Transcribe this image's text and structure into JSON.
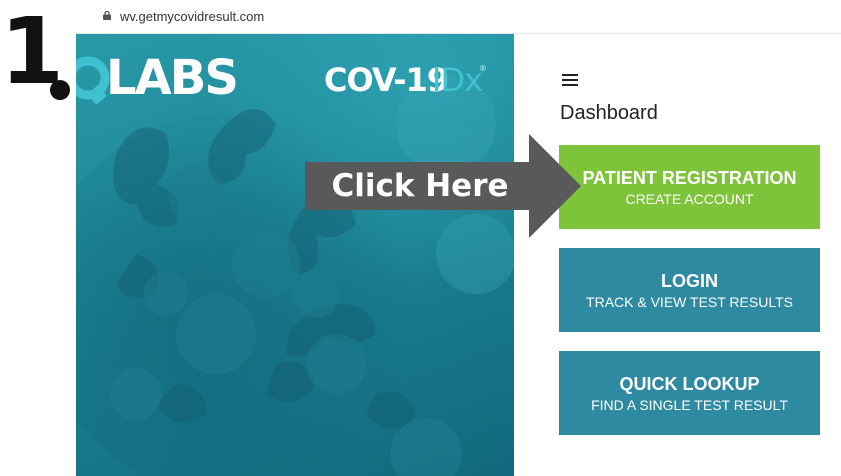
{
  "annotation": {
    "step_number": "1",
    "callout_text": "Click Here"
  },
  "browser": {
    "url": "wv.getmycovidresult.com",
    "icons": {
      "lock": "lock-icon"
    }
  },
  "hero": {
    "brand_logo": "Q",
    "brand_logo_text": "LABS",
    "product_logo_main": "COV-19",
    "product_logo_accent": "IDx",
    "product_logo_mark": "®"
  },
  "dashboard": {
    "menu_icon": "hamburger-menu-icon",
    "title": "Dashboard",
    "buttons": [
      {
        "title": "PATIENT REGISTRATION",
        "subtitle": "CREATE ACCOUNT",
        "color": "#7dc43a"
      },
      {
        "title": "LOGIN",
        "subtitle": "TRACK & VIEW TEST RESULTS",
        "color": "#2d8aa1"
      },
      {
        "title": "QUICK LOOKUP",
        "subtitle": "FIND A SINGLE TEST RESULT",
        "color": "#2d8aa1"
      }
    ]
  },
  "colors": {
    "green": "#7dc43a",
    "teal_button": "#2d8aa1",
    "hero_teal": "#1c8797",
    "arrow_gray": "#595959",
    "idx_accent": "#3fc1d2"
  }
}
